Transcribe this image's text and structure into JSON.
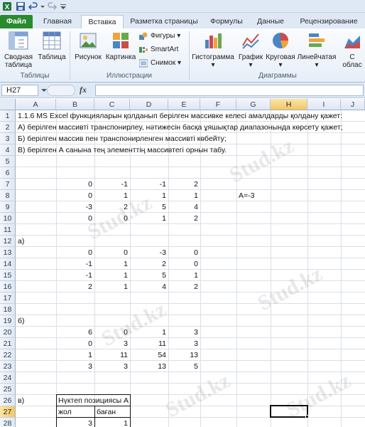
{
  "ribbon": {
    "tabs": [
      "Файл",
      "Главная",
      "Вставка",
      "Разметка страницы",
      "Формулы",
      "Данные",
      "Рецензирование"
    ],
    "buttons": {
      "pivot": "Сводная таблица",
      "table": "Таблица",
      "picture": "Рисунок",
      "clipart": "Картинка",
      "shapes": "Фигуры",
      "smartart": "SmartArt",
      "screenshot": "Снимок",
      "histogram": "Гистограмма",
      "graph": "График",
      "pie": "Круговая",
      "bar": "Линейчатая",
      "area": "С облас"
    },
    "groups": {
      "tables": "Таблицы",
      "illustrations": "Иллюстрации",
      "charts": "Диаграммы"
    }
  },
  "formula_bar": {
    "name_box": "H27",
    "fx": "fx",
    "formula": ""
  },
  "columns": [
    "A",
    "B",
    "C",
    "D",
    "E",
    "F",
    "G",
    "H",
    "I",
    "J"
  ],
  "selected_column": "H",
  "rows": [
    "1",
    "2",
    "3",
    "4",
    "5",
    "6",
    "7",
    "8",
    "9",
    "10",
    "11",
    "12",
    "13",
    "14",
    "15",
    "16",
    "17",
    "18",
    "19",
    "20",
    "21",
    "22",
    "23",
    "24",
    "25",
    "26",
    "27",
    "28"
  ],
  "selected_row": "27",
  "cells": {
    "r1": "1.1.6 MS Excel функцияларын қолданып берілген массивке келесі амалдарды қолдану қажет:",
    "r2": "А) берілген массивті транспонирлеу, нәтижесін басқа ұяшықтар диапазонында көрсету қажет;",
    "r3": "Б) берілген массив пен  транспонирленген массивті көбейту;",
    "r4": "В) берілген А санына тең элементтің массивтегі орнын табу.",
    "matrix_a": [
      [
        "0",
        "-1",
        "-1",
        "2"
      ],
      [
        "0",
        "1",
        "1",
        "1"
      ],
      [
        "-3",
        "2",
        "5",
        "4"
      ],
      [
        "0",
        "0",
        "1",
        "2"
      ]
    ],
    "a_label": "А=-3",
    "label_a": "а)",
    "matrix_t": [
      [
        "0",
        "0",
        "-3",
        "0"
      ],
      [
        "-1",
        "1",
        "2",
        "0"
      ],
      [
        "-1",
        "1",
        "5",
        "1"
      ],
      [
        "2",
        "1",
        "4",
        "2"
      ]
    ],
    "label_b": "б)",
    "matrix_p": [
      [
        "6",
        "0",
        "1",
        "3"
      ],
      [
        "0",
        "3",
        "11",
        "3"
      ],
      [
        "1",
        "11",
        "54",
        "13"
      ],
      [
        "3",
        "3",
        "13",
        "5"
      ]
    ],
    "label_c": "в)",
    "pos_header": "Нүктеп позициясы  А",
    "row_label": "жол",
    "col_label": "баған",
    "row_val": "3",
    "col_val": "1"
  },
  "watermark": "Stud.kz"
}
